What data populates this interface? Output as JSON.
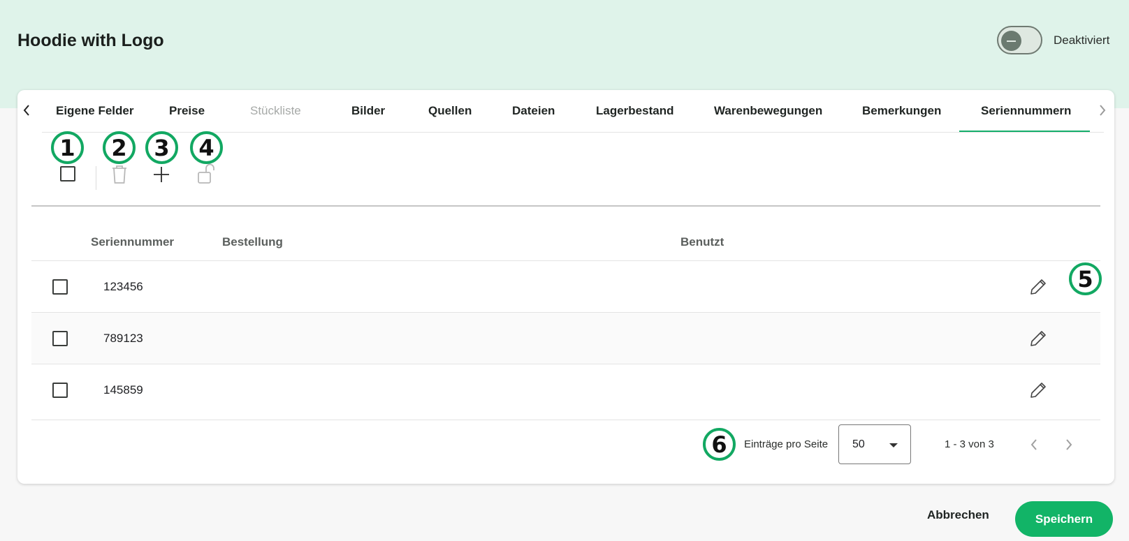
{
  "header": {
    "title": "Hoodie with Logo",
    "status_label": "Deaktiviert",
    "status_active": false
  },
  "tabs": [
    {
      "label": "Eigene Felder",
      "disabled": false,
      "active": false
    },
    {
      "label": "Preise",
      "disabled": false,
      "active": false
    },
    {
      "label": "Stückliste",
      "disabled": true,
      "active": false
    },
    {
      "label": "Bilder",
      "disabled": false,
      "active": false
    },
    {
      "label": "Quellen",
      "disabled": false,
      "active": false
    },
    {
      "label": "Dateien",
      "disabled": false,
      "active": false
    },
    {
      "label": "Lagerbestand",
      "disabled": false,
      "active": false
    },
    {
      "label": "Warenbewegungen",
      "disabled": false,
      "active": false
    },
    {
      "label": "Bemerkungen",
      "disabled": false,
      "active": false
    },
    {
      "label": "Seriennummern",
      "disabled": false,
      "active": true
    }
  ],
  "toolbar": {
    "icons": [
      "select-all-checkbox",
      "trash-icon",
      "plus-icon",
      "unlock-icon"
    ]
  },
  "callouts": [
    "1",
    "2",
    "3",
    "4",
    "5",
    "6"
  ],
  "table": {
    "columns": [
      "Seriennummer",
      "Bestellung",
      "Benutzt"
    ],
    "rows": [
      {
        "serial": "123456",
        "order": "",
        "used": ""
      },
      {
        "serial": "789123",
        "order": "",
        "used": ""
      },
      {
        "serial": "145859",
        "order": "",
        "used": ""
      }
    ]
  },
  "pagination": {
    "per_page_label": "Einträge pro Seite",
    "per_page_value": "50",
    "range_text": "1 - 3 von 3"
  },
  "actions": {
    "cancel_label": "Abbrechen",
    "save_label": "Speichern"
  },
  "colors": {
    "accent": "#12b467",
    "header_background": "#dff3ea",
    "callout_ring": "#12a862"
  }
}
